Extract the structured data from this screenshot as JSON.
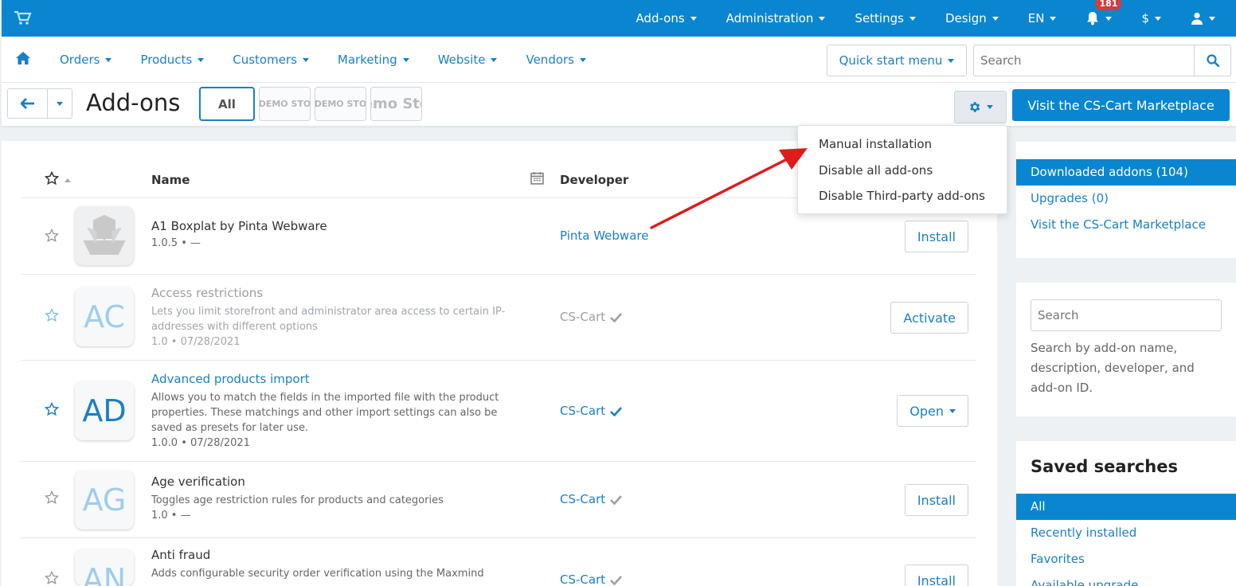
{
  "topbar": {
    "menu": [
      {
        "label": "Add-ons"
      },
      {
        "label": "Administration"
      },
      {
        "label": "Settings"
      },
      {
        "label": "Design"
      },
      {
        "label": "EN"
      }
    ],
    "notifications_count": "181",
    "currency": "$"
  },
  "nav": {
    "items": [
      {
        "label": "Orders"
      },
      {
        "label": "Products"
      },
      {
        "label": "Customers"
      },
      {
        "label": "Marketing"
      },
      {
        "label": "Website"
      },
      {
        "label": "Vendors"
      }
    ],
    "quick_start": "Quick start menu",
    "search_placeholder": "Search"
  },
  "page": {
    "title": "Add-ons",
    "tabs": {
      "all": "All",
      "demo1": "DEMO STO",
      "demo2": "DEMO STO",
      "demo3": "emo Sto"
    },
    "visit_marketplace": "Visit the CS-Cart Marketplace"
  },
  "dropdown": {
    "items": [
      "Manual installation",
      "Disable all add-ons",
      "Disable Third-party add-ons"
    ]
  },
  "table": {
    "headers": {
      "name": "Name",
      "developer": "Developer"
    },
    "rows": [
      {
        "icon_text": "",
        "name": "A1 Boxplat by Pinta Webware",
        "description": "",
        "version": "1.0.5 • —",
        "developer": "Pinta Webware",
        "action": "Install"
      },
      {
        "icon_text": "AC",
        "name": "Access restrictions",
        "description": "Lets you limit storefront and administrator area access to certain IP-addresses with different options",
        "version": "1.0 • 07/28/2021",
        "developer": "CS-Cart",
        "action": "Activate"
      },
      {
        "icon_text": "AD",
        "name": "Advanced products import",
        "description": "Allows you to match the fields in the imported file with the product properties. These matchings and other import settings can also be saved as presets for later use.",
        "version": "1.0.0 • 07/28/2021",
        "developer": "CS-Cart",
        "action": "Open"
      },
      {
        "icon_text": "AG",
        "name": "Age verification",
        "description": "Toggles age restriction rules for products and categories",
        "version": "1.0 • —",
        "developer": "CS-Cart",
        "action": "Install"
      },
      {
        "icon_text": "AN",
        "name": "Anti fraud",
        "description": "Adds configurable security order verification using the Maxmind",
        "version": "",
        "developer": "CS-Cart",
        "action": "Install"
      }
    ]
  },
  "sidebar": {
    "filters": [
      "Downloaded addons (104)",
      "Upgrades (0)",
      "Visit the CS-Cart Marketplace"
    ],
    "search_placeholder": "Search",
    "search_hint": "Search by add-on name, description, developer, and add-on ID.",
    "saved_title": "Saved searches",
    "saved": [
      "All",
      "Recently installed",
      "Favorites",
      "Available upgrade"
    ]
  },
  "colors": {
    "primary": "#0a86d0",
    "link": "#1a7fc7",
    "badge": "#d53c3c",
    "annotation_arrow": "#e01b1b"
  }
}
